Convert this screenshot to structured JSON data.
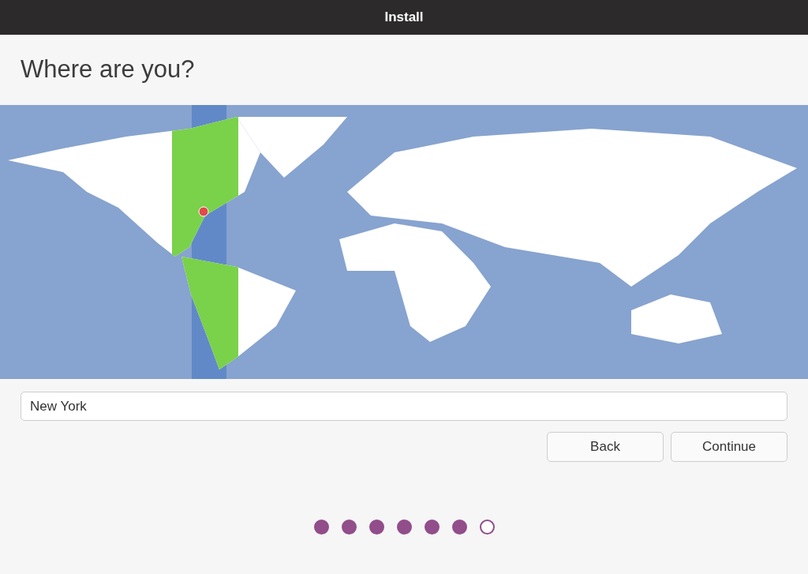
{
  "window": {
    "title": "Install"
  },
  "heading": "Where are you?",
  "location_field": {
    "value": "New York"
  },
  "buttons": [
    "Back",
    "Continue"
  ],
  "progress_steps": [
    {
      "completed": true
    },
    {
      "completed": true
    },
    {
      "completed": true
    },
    {
      "completed": true
    },
    {
      "completed": true
    },
    {
      "completed": true
    },
    {
      "completed": false
    }
  ]
}
